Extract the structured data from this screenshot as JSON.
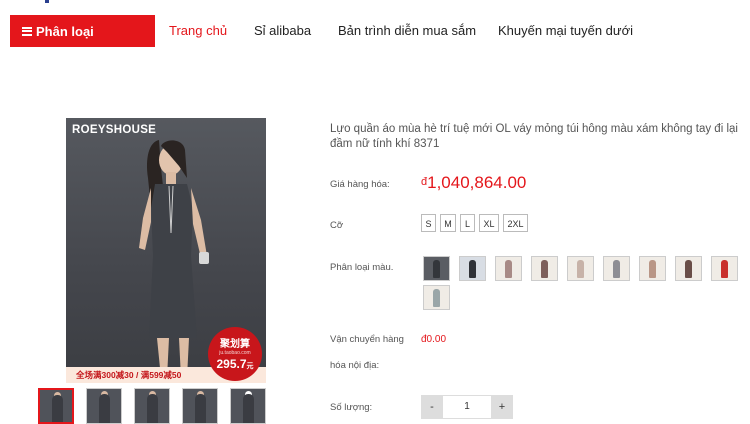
{
  "nav": {
    "category_label": "Phân loại",
    "links": [
      "Trang chủ",
      "Sỉ alibaba",
      "Bản trình diễn mua sắm",
      "Khuyến mại tuyến dưới"
    ]
  },
  "product_image": {
    "brand_text": "ROEYSHOUSE",
    "promo_text": "全场满300减30 / 满599减50",
    "badge_title": "聚划算",
    "badge_sub": "ju.taobao.com",
    "badge_price": "295.7",
    "badge_price_unit": "元"
  },
  "product": {
    "title": "Lựo quần áo mùa hè trí tuệ mới OL váy mỏng túi hông màu xám không tay đi lại đầm nữ tính khí 8371",
    "price_label": "Giá hàng hóa:",
    "price_currency": "đ",
    "price_value": "1,040,864.00",
    "size_label": "Cỡ",
    "sizes": [
      "S",
      "M",
      "L",
      "XL",
      "2XL"
    ],
    "color_label": "Phân loại màu.",
    "shipping_label_1": "Vận chuyển hàng",
    "shipping_label_2": "hóa nội địa:",
    "shipping_value": "đ0.00",
    "qty_label": "Số lượng:",
    "qty_minus": "-",
    "qty_value": "1",
    "qty_plus": "+"
  },
  "colors": {
    "accent": "#e4161b",
    "dress": "#4a4c52"
  },
  "icons": {
    "menu": "menu-icon"
  }
}
